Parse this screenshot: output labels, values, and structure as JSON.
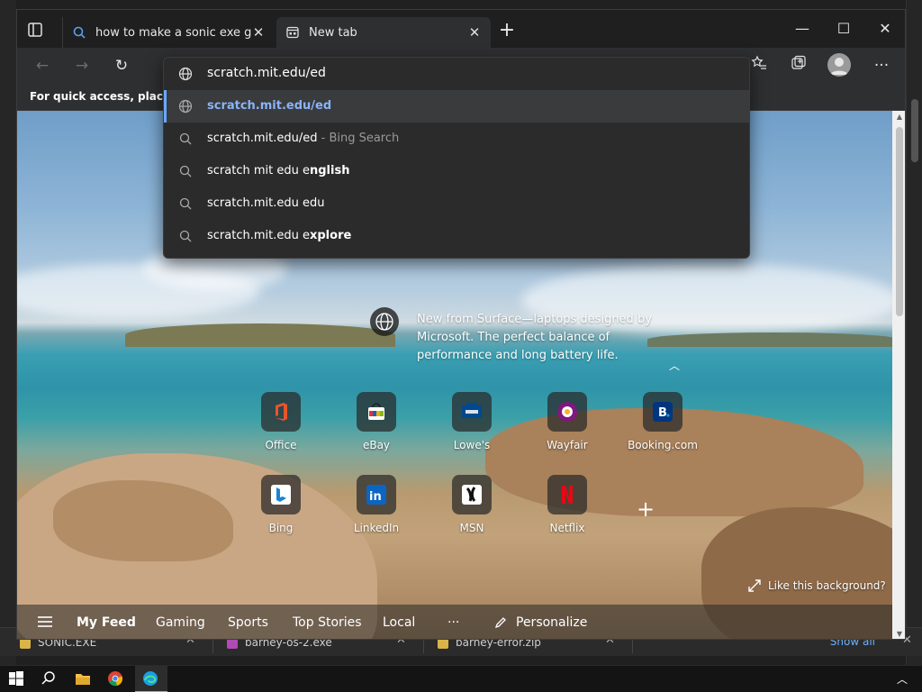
{
  "tabs": [
    {
      "title": "how to make a sonic exe game -"
    },
    {
      "title": "New tab"
    }
  ],
  "favorites_bar": {
    "text": "For quick access, place y"
  },
  "address_bar": {
    "typed": "scratch.mit.edu/ed"
  },
  "suggestions": [
    {
      "text": "scratch.mit.edu/ed",
      "kind": "url"
    },
    {
      "prefix": "scratch.mit.edu/ed",
      "suffix": " - Bing Search",
      "kind": "search"
    },
    {
      "prefix": "scratch mit edu e",
      "bold": "nglish",
      "kind": "search"
    },
    {
      "prefix": "scratch.mit.edu edu",
      "bold": "",
      "kind": "search"
    },
    {
      "prefix": "scratch.mit.edu e",
      "bold": "xplore",
      "kind": "search"
    }
  ],
  "promo": {
    "text": "New from Surface—laptops designed by Microsoft. The perfect balance of performance and long battery life."
  },
  "quick_links": [
    {
      "label": "Office"
    },
    {
      "label": "eBay"
    },
    {
      "label": "Lowe's"
    },
    {
      "label": "Wayfair"
    },
    {
      "label": "Booking.com"
    },
    {
      "label": "Bing"
    },
    {
      "label": "LinkedIn"
    },
    {
      "label": "MSN"
    },
    {
      "label": "Netflix"
    }
  ],
  "background_prompt": "Like this background?",
  "feed_nav": {
    "items": [
      "My Feed",
      "Gaming",
      "Sports",
      "Top Stories",
      "Local"
    ],
    "more": "···",
    "personalize": "Personalize"
  },
  "downloads": [
    {
      "name": "SONIC.EXE"
    },
    {
      "name": "barney-os-2.exe"
    },
    {
      "name": "barney-error.zip"
    }
  ],
  "downloads_show_all": "Show all",
  "colors": {
    "accent": "#8ab4f8",
    "taskbar_active": "#76b9ed",
    "netflix": "#e50914",
    "linkedin": "#0a66c2",
    "booking": "#003580"
  }
}
